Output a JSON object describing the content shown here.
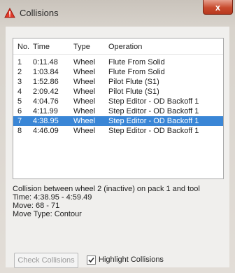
{
  "window": {
    "title": "Collisions",
    "close_glyph": "x"
  },
  "table": {
    "headers": {
      "no": "No.",
      "time": "Time",
      "type": "Type",
      "operation": "Operation"
    },
    "rows": [
      {
        "no": "1",
        "time": "0:11.48",
        "type": "Wheel",
        "operation": "Flute From Solid"
      },
      {
        "no": "2",
        "time": "1:03.84",
        "type": "Wheel",
        "operation": "Flute From Solid"
      },
      {
        "no": "3",
        "time": "1:52.86",
        "type": "Wheel",
        "operation": "Pilot Flute (S1)"
      },
      {
        "no": "4",
        "time": "2:09.42",
        "type": "Wheel",
        "operation": "Pilot Flute (S1)"
      },
      {
        "no": "5",
        "time": "4:04.76",
        "type": "Wheel",
        "operation": "Step Editor - OD Backoff 1"
      },
      {
        "no": "6",
        "time": "4:11.99",
        "type": "Wheel",
        "operation": "Step Editor - OD Backoff 1"
      },
      {
        "no": "7",
        "time": "4:38.95",
        "type": "Wheel",
        "operation": "Step Editor - OD Backoff 1"
      },
      {
        "no": "8",
        "time": "4:46.09",
        "type": "Wheel",
        "operation": "Step Editor - OD Backoff 1"
      }
    ],
    "selected_row": "7"
  },
  "info": {
    "line1": "Collision between wheel 2 (inactive) on pack 1 and tool",
    "line2": "Time: 4:38.95 - 4:59.49",
    "line3": "Move: 68 - 71",
    "line4": "Move Type: Contour"
  },
  "buttons": {
    "check": "Check Collisions"
  },
  "checkbox": {
    "label": "Highlight Collisions",
    "checked": true
  },
  "icons": {
    "title": "warning-icon",
    "check": "checkmark-icon"
  },
  "colors": {
    "selection": "#3a86d6",
    "close": "#c84a2e"
  }
}
